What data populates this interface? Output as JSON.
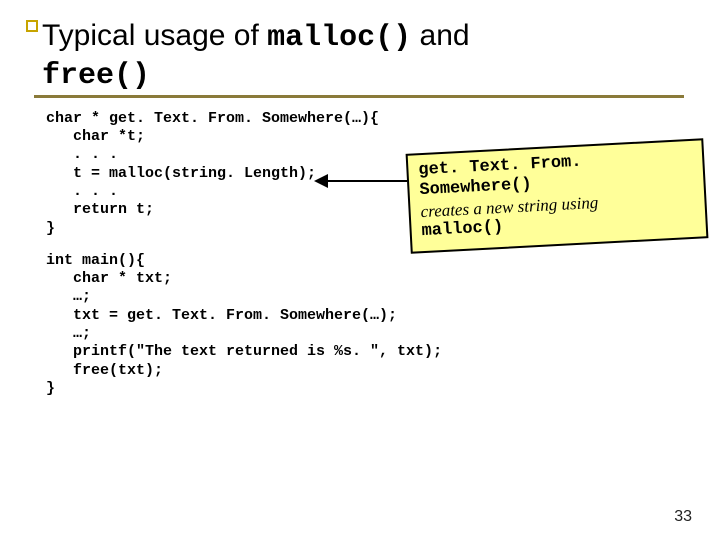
{
  "title": {
    "pre": "Typical usage of ",
    "code1": "malloc()",
    "mid": " and ",
    "code2": "free()"
  },
  "code_block1": "char * get. Text. From. Somewhere(…){\n   char *t;\n   . . .\n   t = malloc(string. Length);\n   . . .\n   return t;\n}",
  "code_block2": "int main(){\n   char * txt;\n   …;\n   txt = get. Text. From. Somewhere(…);\n   …;\n   printf(\"The text returned is %s. \", txt);\n   free(txt);\n}",
  "callout": {
    "line1_code": "get. Text. From. Somewhere()",
    "line2_it": "creates a new string using",
    "line3_code": "malloc()"
  },
  "page_number": "33"
}
